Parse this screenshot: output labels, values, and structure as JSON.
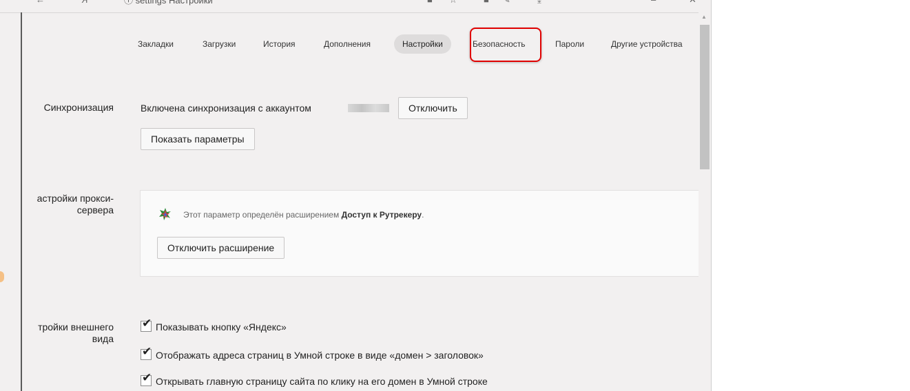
{
  "toolbar": {
    "url_text": "ⓘ settings Настройки"
  },
  "tabs": [
    {
      "label": "Закладки"
    },
    {
      "label": "Загрузки"
    },
    {
      "label": "История"
    },
    {
      "label": "Дополнения"
    },
    {
      "label": "Настройки",
      "active": true
    },
    {
      "label": "Безопасность",
      "highlighted": true
    },
    {
      "label": "Пароли"
    },
    {
      "label": "Другие устройства"
    }
  ],
  "sync": {
    "section_label": "Синхронизация",
    "status_text": "Включена синхронизация с аккаунтом",
    "disable_button": "Отключить",
    "show_params_button": "Показать параметры"
  },
  "proxy": {
    "section_label_line1": "астройки прокси-",
    "section_label_line2": "сервера",
    "notice_prefix": "Этот параметр определён расширением ",
    "extension_name": "Доступ к Рутрекеру",
    "notice_suffix": ".",
    "disable_extension_button": "Отключить расширение"
  },
  "appearance": {
    "section_label_line1": "тройки внешнего",
    "section_label_line2": "вида",
    "options": [
      {
        "label": "Показывать кнопку «Яндекс»",
        "checked": true
      },
      {
        "label": "Отображать адреса страниц в Умной строке в виде «домен > заголовок»",
        "checked": true
      },
      {
        "label": "Открывать главную страницу сайта по клику на его домен в Умной строке",
        "checked": true
      }
    ]
  },
  "colors": {
    "highlight": "#e00000",
    "active_tab_bg": "#dedcdc",
    "page_bg": "#f2f0f0"
  }
}
